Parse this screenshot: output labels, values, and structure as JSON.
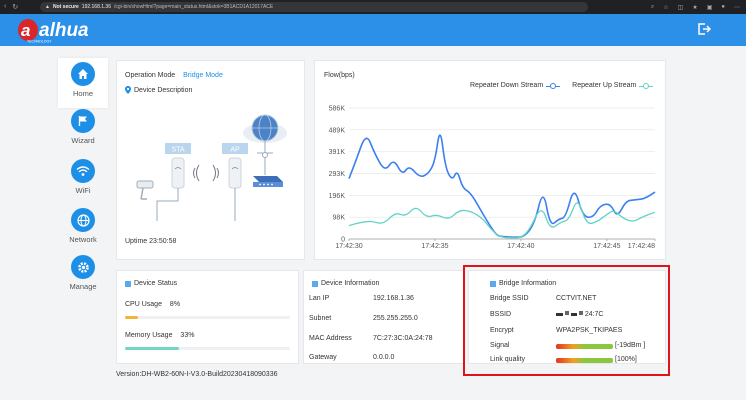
{
  "browser": {
    "warning": "Not secure",
    "url_host": "192.168.1.36",
    "url_path": "/cgi-bin/showHtml?page=main_status.html&stok=3B1ACD1A12017ACE"
  },
  "header": {
    "brand": "alhua",
    "brand_sub": "TECHNOLOGY",
    "accent": "#2c8fe8"
  },
  "nav": [
    {
      "label": "Home",
      "icon": "home-icon",
      "active": true
    },
    {
      "label": "Wizard",
      "icon": "flag-icon",
      "active": false
    },
    {
      "label": "WiFi",
      "icon": "wifi-icon",
      "active": false
    },
    {
      "label": "Network",
      "icon": "globe-icon",
      "active": false
    },
    {
      "label": "Manage",
      "icon": "gear-icon",
      "active": false
    }
  ],
  "operation": {
    "mode_label": "Operation Mode",
    "mode_value": "Bridge Mode",
    "desc_label": "Device Description",
    "sta_label": "STA",
    "ap_label": "AP",
    "uptime_label": "Uptime",
    "uptime_value": "23:50:58"
  },
  "chart_data": {
    "type": "line",
    "title": "Flow(bps)",
    "x": [
      "17:42:30",
      "17:42:35",
      "17:42:40",
      "17:42:45",
      "17:42:48"
    ],
    "y_ticks": [
      "0",
      "98K",
      "196K",
      "293K",
      "391K",
      "489K",
      "586K"
    ],
    "ylim": [
      0,
      586
    ],
    "legend_placement": "top-right",
    "series": [
      {
        "name": "Repeater Down Stream",
        "color": "#3c7ff0",
        "values": [
          [
            0,
            270
          ],
          [
            0.4,
            350
          ],
          [
            1.0,
            478
          ],
          [
            1.5,
            380
          ],
          [
            2.1,
            300
          ],
          [
            2.6,
            360
          ],
          [
            3.1,
            285
          ],
          [
            3.5,
            330
          ],
          [
            4.1,
            275
          ],
          [
            4.6,
            290
          ],
          [
            5.0,
            345
          ],
          [
            5.3,
            508
          ],
          [
            5.6,
            320
          ],
          [
            6.0,
            260
          ],
          [
            6.3,
            310
          ],
          [
            6.6,
            228
          ],
          [
            7.1,
            205
          ],
          [
            7.8,
            110
          ],
          [
            8.2,
            60
          ],
          [
            8.6,
            15
          ],
          [
            9.0,
            10
          ],
          [
            9.6,
            8
          ],
          [
            10.2,
            8
          ],
          [
            10.8,
            70
          ],
          [
            11.3,
            228
          ],
          [
            11.7,
            55
          ],
          [
            12.2,
            90
          ],
          [
            12.6,
            95
          ],
          [
            13.1,
            240
          ],
          [
            13.6,
            100
          ],
          [
            14.2,
            95
          ],
          [
            14.6,
            150
          ],
          [
            15.2,
            160
          ],
          [
            15.6,
            95
          ],
          [
            16.1,
            170
          ],
          [
            16.6,
            175
          ],
          [
            17.2,
            180
          ],
          [
            17.8,
            210
          ]
        ]
      },
      {
        "name": "Repeater Up Stream",
        "color": "#60d4c4",
        "values": [
          [
            0,
            60
          ],
          [
            0.7,
            75
          ],
          [
            1.3,
            80
          ],
          [
            2.0,
            65
          ],
          [
            2.7,
            120
          ],
          [
            3.3,
            100
          ],
          [
            3.9,
            150
          ],
          [
            4.5,
            95
          ],
          [
            5.1,
            110
          ],
          [
            5.8,
            85
          ],
          [
            6.4,
            130
          ],
          [
            7.1,
            125
          ],
          [
            7.8,
            90
          ],
          [
            8.3,
            40
          ],
          [
            8.8,
            8
          ],
          [
            9.4,
            5
          ],
          [
            10.0,
            5
          ],
          [
            10.5,
            40
          ],
          [
            11.2,
            155
          ],
          [
            11.7,
            40
          ],
          [
            12.3,
            75
          ],
          [
            12.8,
            85
          ],
          [
            13.3,
            190
          ],
          [
            13.8,
            65
          ],
          [
            14.4,
            75
          ],
          [
            15.0,
            110
          ],
          [
            15.4,
            130
          ],
          [
            15.9,
            95
          ],
          [
            16.5,
            75
          ],
          [
            17.1,
            100
          ],
          [
            17.8,
            120
          ]
        ]
      }
    ]
  },
  "device_status": {
    "title": "Device Status",
    "cpu_label": "CPU Usage",
    "cpu_value": "8%",
    "cpu_fraction": 0.08,
    "mem_label": "Memory Usage",
    "mem_value": "33%",
    "mem_fraction": 0.33
  },
  "device_info": {
    "title": "Device Information",
    "rows": [
      {
        "label": "Lan IP",
        "value": "192.168.1.36"
      },
      {
        "label": "Subnet",
        "value": "255.255.255.0"
      },
      {
        "label": "MAC Address",
        "value": "7C:27:3C:0A:24:78"
      },
      {
        "label": "Gateway",
        "value": "0.0.0.0"
      }
    ]
  },
  "bridge_info": {
    "title": "Bridge Information",
    "ssid_label": "Bridge SSID",
    "ssid_value": "CCTVIT.NET",
    "bssid_label": "BSSID",
    "bssid_value": "24:7C",
    "encrypt_label": "Encrypt",
    "encrypt_value": "WPA2PSK_TKIPAES",
    "signal_label": "Signal",
    "signal_value": "[-19dBm ]",
    "link_label": "Link quality",
    "link_value": "[100%]",
    "link_fraction": 1.0
  },
  "footer": {
    "version": "Version:DH-WB2-60N-I-V3.0-Build20230418090336"
  }
}
